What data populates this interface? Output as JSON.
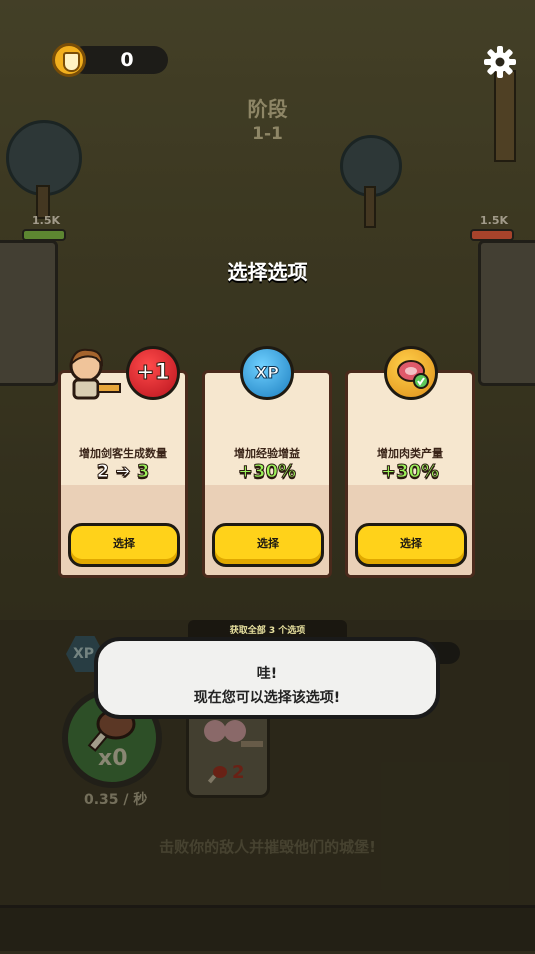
{
  "header": {
    "coins": "0",
    "settings_icon": "gear-icon",
    "currency_icon": "shield-coin-icon"
  },
  "stage": {
    "label": "阶段",
    "number": "1-1"
  },
  "bases": {
    "player_hp": "1.5K",
    "enemy_hp": "1.5K"
  },
  "dialog": {
    "title": "选择选项",
    "cards": [
      {
        "description": "增加剑客生成数量",
        "from": "2",
        "to": "3",
        "badge": "+1",
        "button": "选择",
        "icon": "swordsman-icon"
      },
      {
        "description": "增加经验增益",
        "value": "+30%",
        "badge": "XP",
        "button": "选择",
        "icon": "xp-icon"
      },
      {
        "description": "增加肉类产量",
        "value": "+30%",
        "button": "选择",
        "icon": "meat-boost-icon"
      }
    ]
  },
  "tutorial": {
    "banner": "获取全部 3 个选项",
    "line1": "哇!",
    "line2": "现在您可以选择该选项!"
  },
  "hud": {
    "xp_label": "XP",
    "meat_count": "x0",
    "rate": "0.35 / 秒",
    "unit_cost": "2",
    "hint": "击败你的敌人并摧毁他们的城堡!"
  },
  "colors": {
    "button": "#ffd21a",
    "value_green": "#9cf25a",
    "badge_red": "#d8202a",
    "badge_blue": "#2fa6e0",
    "badge_orange": "#f0a020"
  }
}
